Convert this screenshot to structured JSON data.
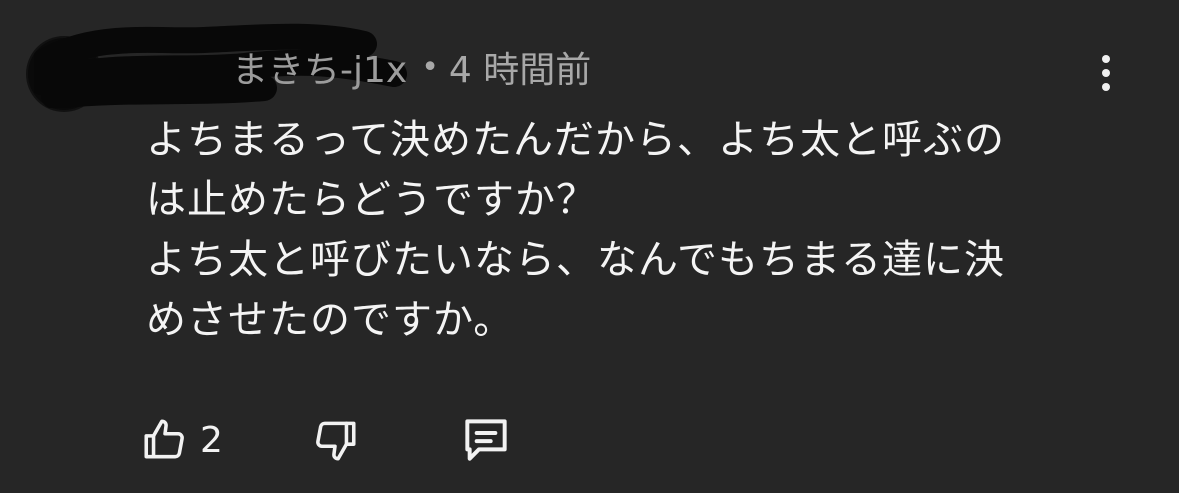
{
  "comment": {
    "author_handle": "まきち-j1x",
    "separator": "•",
    "timestamp": "4 時間前",
    "body_lines": [
      "よちまるって決めたんだから、よち太と呼ぶの",
      "は止めたらどうですか？",
      "よち太と呼びたいなら、なんでもちまる達に決",
      "めさせたのですか。"
    ],
    "like_count": "2"
  },
  "icons": {
    "more": "more-vertical-icon",
    "like": "thumbs-up-icon",
    "dislike": "thumbs-down-icon",
    "reply": "comment-icon"
  },
  "colors": {
    "background": "#262626",
    "text": "#f4f4f4",
    "meta": "#a8a8a8"
  }
}
